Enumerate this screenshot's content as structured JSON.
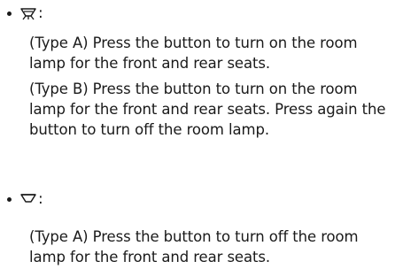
{
  "content": {
    "items": [
      {
        "icon": "room-lamp-on-icon",
        "colon": ":",
        "paragraphs": [
          "(Type A) Press the button to turn on the room lamp for the front and rear seats.",
          "(Type B) Press the button to turn on the room lamp for the front and rear seats. Press again the button to turn off the room lamp."
        ]
      },
      {
        "icon": "room-lamp-off-icon",
        "colon": ":",
        "paragraphs": [
          "(Type A) Press the button to turn off the room lamp for the front and rear seats."
        ]
      }
    ]
  },
  "colors": {
    "text": "#1a1a1a",
    "background": "#ffffff"
  }
}
